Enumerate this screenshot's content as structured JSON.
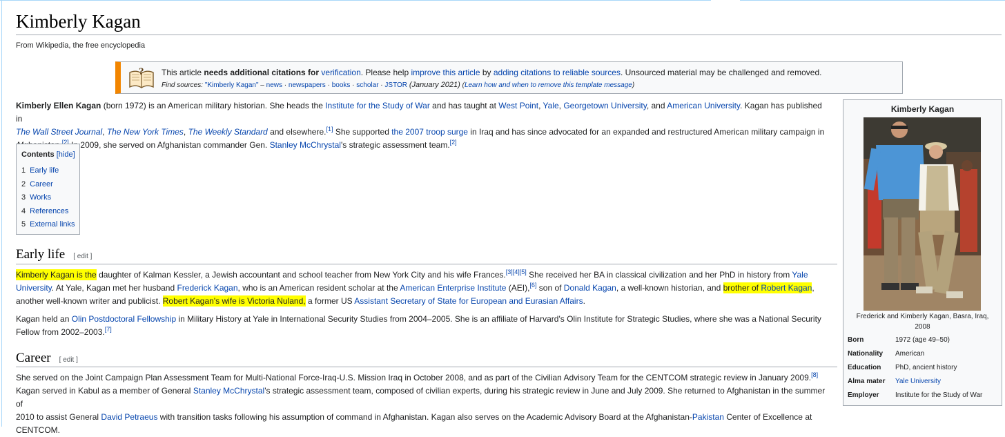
{
  "page": {
    "title": "Kimberly Kagan",
    "tagline": "From Wikipedia, the free encyclopedia"
  },
  "ambox": {
    "t1": "This article ",
    "t2": "needs additional citations for ",
    "t3": "verification",
    "t4": ". Please help ",
    "t5": "improve this article",
    "t6": " by ",
    "t7": "adding citations to reliable sources",
    "t8": ". Unsourced material may be challenged and removed.",
    "find_label": "Find sources: ",
    "find_query": "\"Kimberly Kagan\"",
    "dash": " – ",
    "src_news": "news",
    "src_newspapers": "newspapers",
    "src_books": "books",
    "src_scholar": "scholar",
    "src_jstor": "JSTOR",
    "sep": " · ",
    "date": "(January 2021)",
    "learn_open": "(",
    "learn": "Learn how and when to remove this template message",
    "learn_close": ")"
  },
  "intro": {
    "l1_a": "Kimberly Ellen Kagan",
    "l1_b": " (born 1972) is an American military historian. She heads the ",
    "l1_c": "Institute for the Study of War",
    "l1_d": " and has taught at ",
    "l1_e": "West Point",
    "l1_f": ", ",
    "l1_g": "Yale",
    "l1_h": ", ",
    "l1_i": "Georgetown University",
    "l1_j": ", and ",
    "l1_k": "American University",
    "l1_l": ". Kagan has published in",
    "l2_a": "The Wall Street Journal",
    "l2_b": ", ",
    "l2_c": "The New York Times",
    "l2_d": ", ",
    "l2_e": "The Weekly Standard",
    "l2_f": " and elsewhere.",
    "l2_ref": "[1]",
    "l2_g": " She supported ",
    "l2_h": "the 2007 troop surge",
    "l2_i": " in Iraq and has since advocated for an expanded and restructured American military campaign in",
    "l3_a": "Afghanistan.",
    "l3_ref1": "[2]",
    "l3_b": " In 2009, she served on Afghanistan commander Gen. ",
    "l3_c": "Stanley McChrystal",
    "l3_d": "'s strategic assessment team.",
    "l3_ref2": "[2]"
  },
  "toc": {
    "title": "Contents",
    "hide": "[hide]",
    "items": [
      {
        "num": "1",
        "label": "Early life"
      },
      {
        "num": "2",
        "label": "Career"
      },
      {
        "num": "3",
        "label": "Works"
      },
      {
        "num": "4",
        "label": "References"
      },
      {
        "num": "5",
        "label": "External links"
      }
    ]
  },
  "early_life": {
    "heading": "Early life",
    "edit": "[ edit ]",
    "p1_l1_hl": "Kimberly Kagan is the",
    "p1_l1_a": " daughter of Kalman Kessler, a Jewish accountant and school teacher from New York City and his wife Frances.",
    "p1_l1_ref": "[3][4][5]",
    "p1_l1_b": " She received her BA in classical civilization and her PhD in history from ",
    "p1_l1_c": "Yale",
    "p1_l2_a": "University",
    "p1_l2_b": ". At Yale, Kagan met her husband ",
    "p1_l2_c": "Frederick Kagan",
    "p1_l2_d": ", who is an American resident scholar at the ",
    "p1_l2_e": "American Enterprise Institute",
    "p1_l2_f": " (AEI),",
    "p1_l2_ref": "[6]",
    "p1_l2_g": " son of ",
    "p1_l2_h": "Donald Kagan",
    "p1_l2_i": ", a well-known historian, and ",
    "p1_l2_hl1": "brother of ",
    "p1_l2_hl2": "Robert Kagan",
    "p1_l2_j": ",",
    "p1_l3_a": "another well-known writer and publicist. ",
    "p1_l3_hl": "Robert Kagan's wife is Victoria Nuland,",
    "p1_l3_b": " a former US ",
    "p1_l3_c": "Assistant Secretary of State for European and Eurasian Affairs",
    "p1_l3_d": ".",
    "p2_l1_a": "Kagan held an ",
    "p2_l1_b": "Olin Postdoctoral Fellowship",
    "p2_l1_c": " in Military History at Yale in International Security Studies from 2004–2005. She is an affiliate of Harvard's Olin Institute for Strategic Studies, where she was a National Security",
    "p2_l2_a": "Fellow from 2002–2003.",
    "p2_l2_ref": "[7]"
  },
  "career": {
    "heading": "Career",
    "edit": "[ edit ]",
    "l1_a": "She served on the Joint Campaign Plan Assessment Team for Multi-National Force-Iraq-U.S. Mission Iraq in October 2008, and as part of the Civilian Advisory Team for the CENTCOM strategic review in January 2009.",
    "l1_ref": "[8]",
    "l2_a": "Kagan served in Kabul as a member of General ",
    "l2_b": "Stanley McChrystal",
    "l2_c": "'s strategic assessment team, composed of civilian experts, during his strategic review in June and July 2009. She returned to Afghanistan in the summer of",
    "l3_a": "2010 to assist General ",
    "l3_b": "David Petraeus",
    "l3_c": " with transition tasks following his assumption of command in Afghanistan. Kagan also serves on the Academic Advisory Board at the Afghanistan-",
    "l3_d": "Pakistan",
    "l3_e": " Center of Excellence at",
    "l4_a": "CENTCOM."
  },
  "infobox": {
    "title": "Kimberly Kagan",
    "caption": "Frederick and Kimberly Kagan, Basra, Iraq, 2008",
    "rows": [
      {
        "label": "Born",
        "value": "1972 (age 49–50)"
      },
      {
        "label": "Nationality",
        "value": "American"
      },
      {
        "label": "Education",
        "value": "PhD, ancient history"
      },
      {
        "label": "Alma mater",
        "value": "Yale University"
      },
      {
        "label": "Employer",
        "value": "Institute for the Study of War"
      }
    ]
  },
  "colors": {
    "link": "#0645ad",
    "highlight": "#ffff00",
    "ambox_stripe": "#f28500"
  }
}
